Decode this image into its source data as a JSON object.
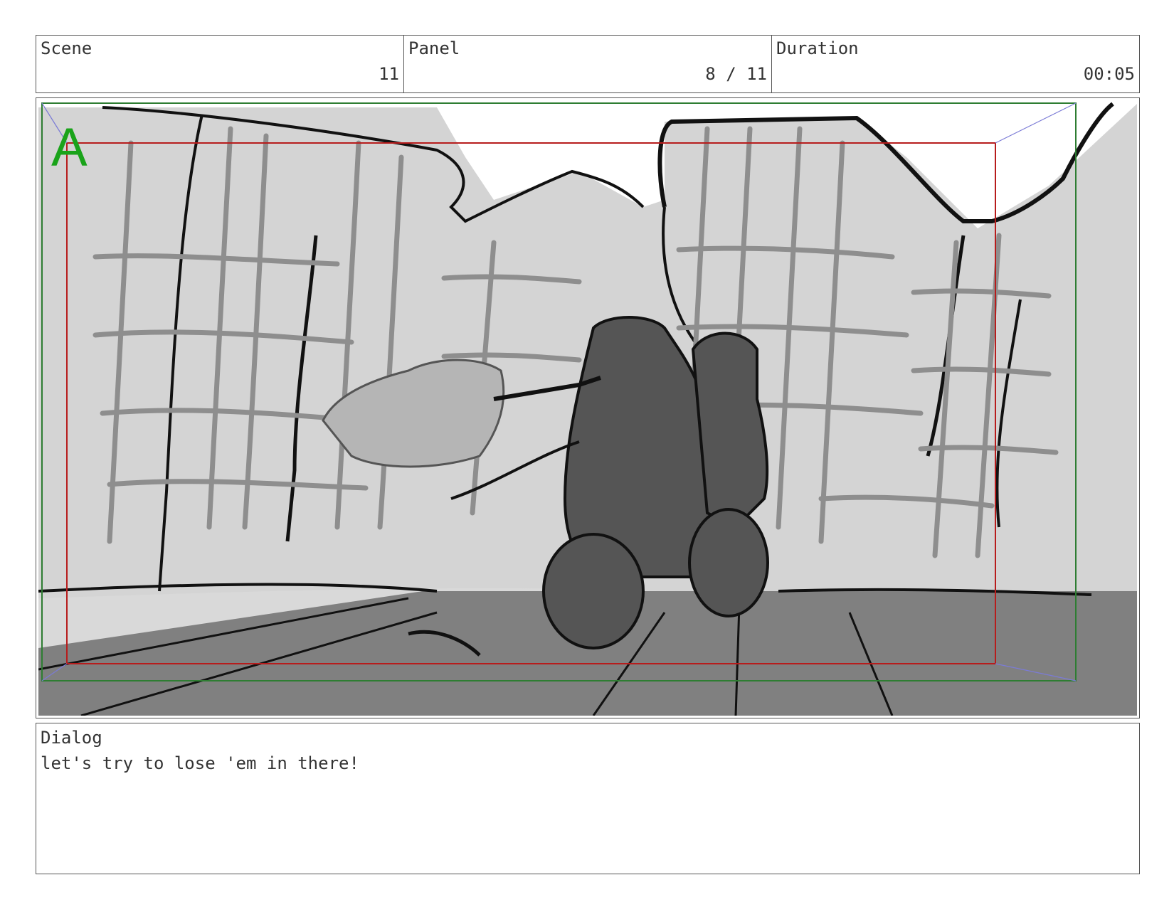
{
  "header": {
    "scene": {
      "label": "Scene",
      "value": "11"
    },
    "panel": {
      "label": "Panel",
      "value": "8 / 11"
    },
    "duration": {
      "label": "Duration",
      "value": "00:05"
    }
  },
  "frame": {
    "camera_label": "A",
    "colors": {
      "safe_frame": "#2e7d32",
      "action_frame": "#b71c1c",
      "camera_label": "#1aa31a"
    }
  },
  "dialog": {
    "label": "Dialog",
    "text": "let's try to lose 'em in there!"
  }
}
